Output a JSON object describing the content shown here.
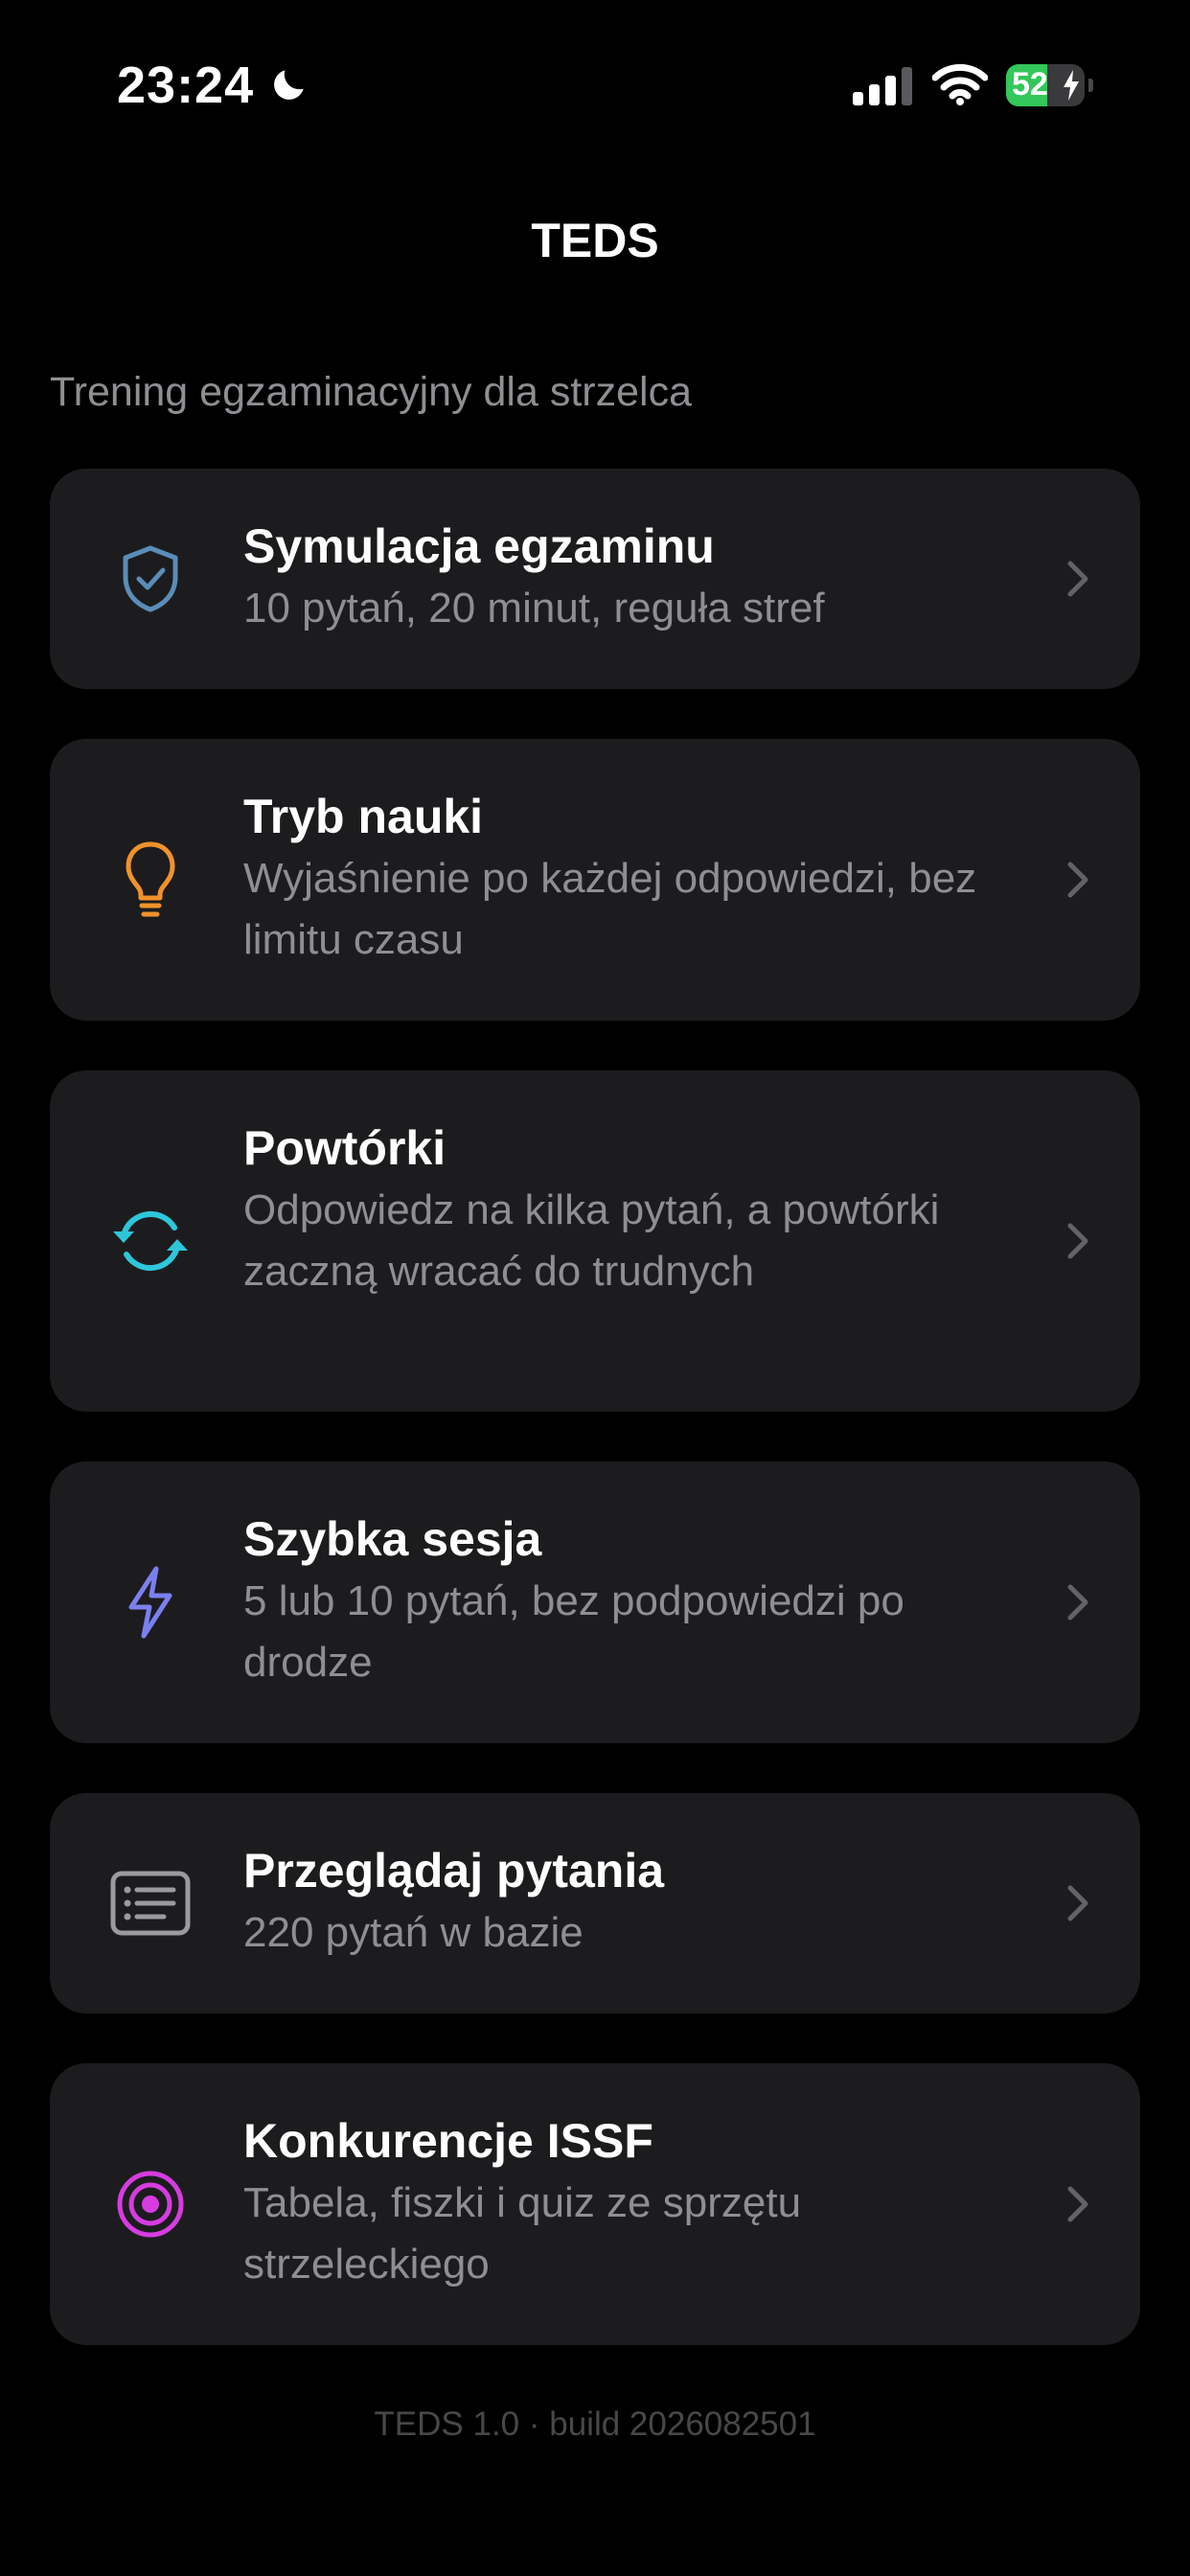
{
  "status_bar": {
    "time": "23:24",
    "battery_level": "52",
    "battery_fraction": 0.52,
    "icons": [
      "moon-icon",
      "signal-icon",
      "wifi-icon",
      "battery-icon"
    ]
  },
  "nav": {
    "title": "TEDS"
  },
  "subtitle": "Trening egzaminacyjny dla strzelca",
  "menu": [
    {
      "title": "Symulacja egzaminu",
      "description": "10 pytań, 20 minut, reguła stref",
      "icon": "shield-check-icon",
      "color": "#5b8db8"
    },
    {
      "title": "Tryb nauki",
      "description": "Wyjaśnienie po każdej odpowiedzi, bez limitu czasu",
      "icon": "lightbulb-icon",
      "color": "#f0922b"
    },
    {
      "title": "Powtórki",
      "description": "Odpowiedz na kilka pytań, a powtórki zaczną wracać do trudnych",
      "icon": "refresh-icon",
      "color": "#2ec6d9"
    },
    {
      "title": "Szybka sesja",
      "description": "5 lub 10 pytań, bez podpowiedzi po drodze",
      "icon": "bolt-icon",
      "color": "#7b7ff0"
    },
    {
      "title": "Przeglądaj pytania",
      "description": "220 pytań w bazie",
      "icon": "list-icon",
      "color": "#9a9a9f"
    },
    {
      "title": "Konkurencje ISSF",
      "description": "Tabela, fiszki i quiz ze sprzętu strzeleckiego",
      "icon": "target-icon",
      "color": "#d63ce0"
    }
  ],
  "footer": "TEDS 1.0 · build 2026082501"
}
